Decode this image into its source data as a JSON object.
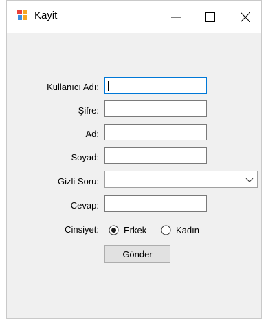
{
  "window": {
    "title": "Kayit",
    "icons": {
      "app": "form-app-icon",
      "minimize": "minimize-icon",
      "maximize": "maximize-icon",
      "close": "close-icon"
    }
  },
  "form": {
    "username_label": "Kullanıcı Adı:",
    "username_value": "",
    "password_label": "Şifre:",
    "password_value": "",
    "name_label": "Ad:",
    "name_value": "",
    "surname_label": "Soyad:",
    "surname_value": "",
    "secret_question_label": "Gizli Soru:",
    "secret_question_value": "",
    "answer_label": "Cevap:",
    "answer_value": "",
    "gender_label": "Cinsiyet:",
    "gender_options": [
      {
        "label": "Erkek",
        "selected": true
      },
      {
        "label": "Kadın",
        "selected": false
      }
    ],
    "submit_label": "Gönder"
  },
  "colors": {
    "focus_border": "#0078d7",
    "window_bg": "#f0f0f0",
    "button_bg": "#e1e1e1"
  }
}
